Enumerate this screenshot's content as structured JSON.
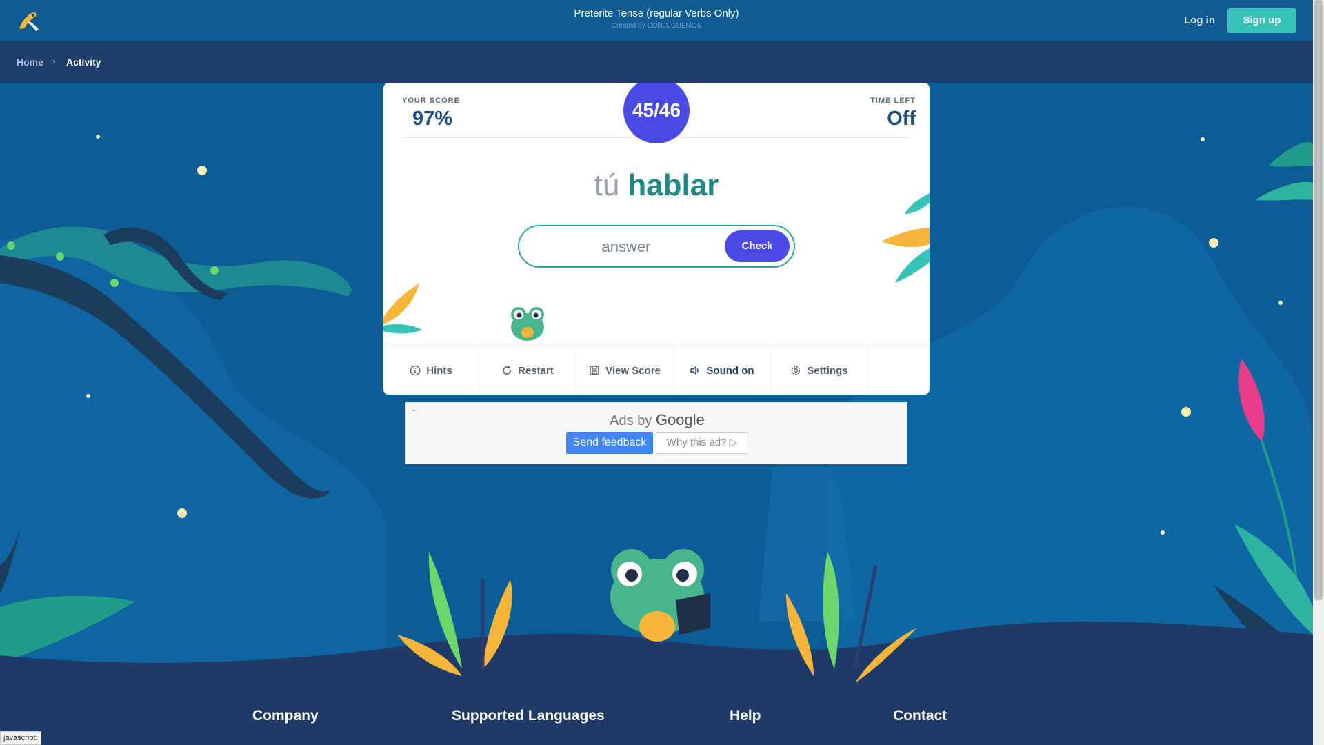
{
  "header": {
    "title": "Preterite Tense (regular Verbs Only)",
    "subtitle": "Created by CONJUGUEMOS",
    "login_label": "Log in",
    "signup_label": "Sign up"
  },
  "breadcrumb": {
    "home": "Home",
    "separator": "›",
    "current": "Activity"
  },
  "activity": {
    "score_label": "YOUR SCORE",
    "score_value": "97%",
    "progress": "45/46",
    "time_label": "TIME LEFT",
    "time_value": "Off",
    "pronoun": "tú",
    "verb": "hablar",
    "answer_placeholder": "answer",
    "check_label": "Check"
  },
  "toolbar": {
    "items": [
      {
        "label": "Hints",
        "icon": "info-icon"
      },
      {
        "label": "Restart",
        "icon": "restart-icon"
      },
      {
        "label": "View Score",
        "icon": "save-icon"
      },
      {
        "label": "Sound on",
        "icon": "speaker-icon"
      },
      {
        "label": "Settings",
        "icon": "gear-icon"
      }
    ]
  },
  "ad": {
    "back_arrow": "←",
    "ads_by": "Ads by",
    "google": "Google",
    "send_feedback": "Send feedback",
    "why_this_ad": "Why this ad? ▷"
  },
  "footer": {
    "columns": [
      "Company",
      "Supported Languages",
      "Help",
      "Contact"
    ]
  },
  "status_bar": "javascript:",
  "colors": {
    "accent": "#4b4ae6",
    "teal": "#2aa99e",
    "header_bg": "#115b93",
    "footer_bg": "#1f3a66",
    "page_bg": "#0c5d96"
  }
}
